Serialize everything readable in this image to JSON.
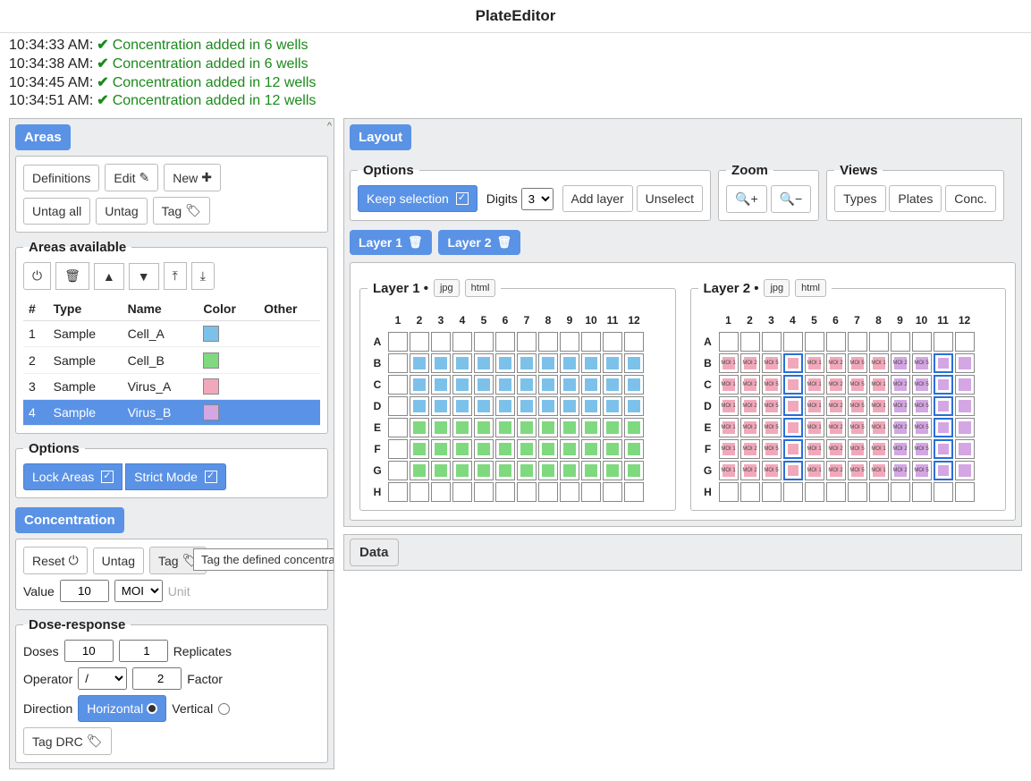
{
  "app_title": "PlateEditor",
  "log": [
    {
      "time": "10:34:33 AM:",
      "msg": "Concentration added in 6 wells"
    },
    {
      "time": "10:34:38 AM:",
      "msg": "Concentration added in 6 wells"
    },
    {
      "time": "10:34:45 AM:",
      "msg": "Concentration added in 12 wells"
    },
    {
      "time": "10:34:51 AM:",
      "msg": "Concentration added in 12 wells"
    }
  ],
  "areas": {
    "title": "Areas",
    "btn_definitions": "Definitions",
    "btn_edit": "Edit",
    "btn_new": "New",
    "btn_untag_all": "Untag all",
    "btn_untag": "Untag",
    "btn_tag": "Tag",
    "available_title": "Areas available",
    "cols": {
      "num": "#",
      "type": "Type",
      "name": "Name",
      "color": "Color",
      "other": "Other"
    },
    "rows": [
      {
        "num": "1",
        "type": "Sample",
        "name": "Cell_A",
        "color": "#7cc1ea",
        "selected": false
      },
      {
        "num": "2",
        "type": "Sample",
        "name": "Cell_B",
        "color": "#7fd97f",
        "selected": false
      },
      {
        "num": "3",
        "type": "Sample",
        "name": "Virus_A",
        "color": "#f2a8bb",
        "selected": false
      },
      {
        "num": "4",
        "type": "Sample",
        "name": "Virus_B",
        "color": "#d4a6e3",
        "selected": true
      }
    ],
    "options_title": "Options",
    "lock_areas": "Lock Areas",
    "strict_mode": "Strict Mode"
  },
  "concentration": {
    "title": "Concentration",
    "reset": "Reset",
    "untag": "Untag",
    "tag": "Tag",
    "value_label": "Value",
    "value": "10",
    "unit_sel": "MOI",
    "unit_label": "Unit",
    "dose_title": "Dose-response",
    "doses_label": "Doses",
    "doses": "10",
    "replicates": "1",
    "replicates_label": "Replicates",
    "operator_label": "Operator",
    "operator": "/",
    "factor": "2",
    "factor_label": "Factor",
    "direction_label": "Direction",
    "horizontal": "Horizontal",
    "vertical": "Vertical",
    "tag_drc": "Tag DRC",
    "tooltip": "Tag the defined concentrations in the selection"
  },
  "layout": {
    "title": "Layout",
    "options_title": "Options",
    "keep_selection": "Keep selection",
    "digits_label": "Digits",
    "digits": "3",
    "add_layer": "Add layer",
    "unselect": "Unselect",
    "zoom_title": "Zoom",
    "views_title": "Views",
    "types": "Types",
    "plates": "Plates",
    "conc": "Conc.",
    "tab_layer1": "Layer 1",
    "tab_layer2": "Layer 2",
    "plate1_title": "Layer 1 •",
    "plate2_title": "Layer 2 •",
    "jpg": "jpg",
    "html": "html",
    "data": "Data"
  },
  "plate": {
    "cols": [
      "1",
      "2",
      "3",
      "4",
      "5",
      "6",
      "7",
      "8",
      "9",
      "10",
      "11",
      "12"
    ],
    "rows": [
      "A",
      "B",
      "C",
      "D",
      "E",
      "F",
      "G",
      "H"
    ]
  },
  "layer1_colors": {
    "blue": "#7cc1ea",
    "green": "#7fd97f"
  },
  "layer2": {
    "pink": "#f2a8bb",
    "purple": "#d4a6e3",
    "label_prefix": "MOI"
  }
}
